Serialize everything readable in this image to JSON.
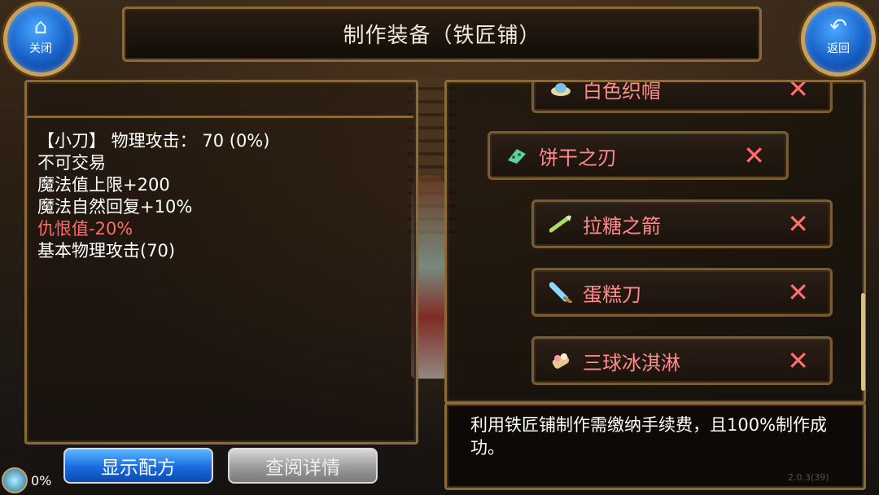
{
  "header": {
    "title": "制作装备（铁匠铺）",
    "close_label": "关闭",
    "back_label": "返回"
  },
  "item_detail": {
    "line1": "【小刀】 物理攻击：  70 (0%)",
    "line2": "不可交易",
    "line3": "魔法值上限+200",
    "line4": "魔法自然回复+10%",
    "line5": "仇恨值-20%",
    "line6": "基本物理攻击(70)"
  },
  "recipe_list": {
    "items": [
      {
        "label": "白色织帽",
        "icon": "hat-icon"
      },
      {
        "label": "饼干之刃",
        "icon": "cookie-blade-icon"
      },
      {
        "label": "拉糖之箭",
        "icon": "candy-arrow-icon"
      },
      {
        "label": "蛋糕刀",
        "icon": "cake-knife-icon"
      },
      {
        "label": "三球冰淇淋",
        "icon": "ice-cream-icon"
      }
    ],
    "remove_symbol": "✕"
  },
  "description": "利用铁匠铺制作需缴纳手续费，且100%制作成功。",
  "buttons": {
    "show_recipe": "显示配方",
    "view_details": "查阅详情"
  },
  "status": {
    "progress": "0%",
    "version": "2.0.3(39)"
  },
  "colors": {
    "frame": "#8a6a3a",
    "item_name": "#ff8a8a",
    "negative_stat": "#ff6a6a",
    "primary_button": "#1a6adf"
  }
}
